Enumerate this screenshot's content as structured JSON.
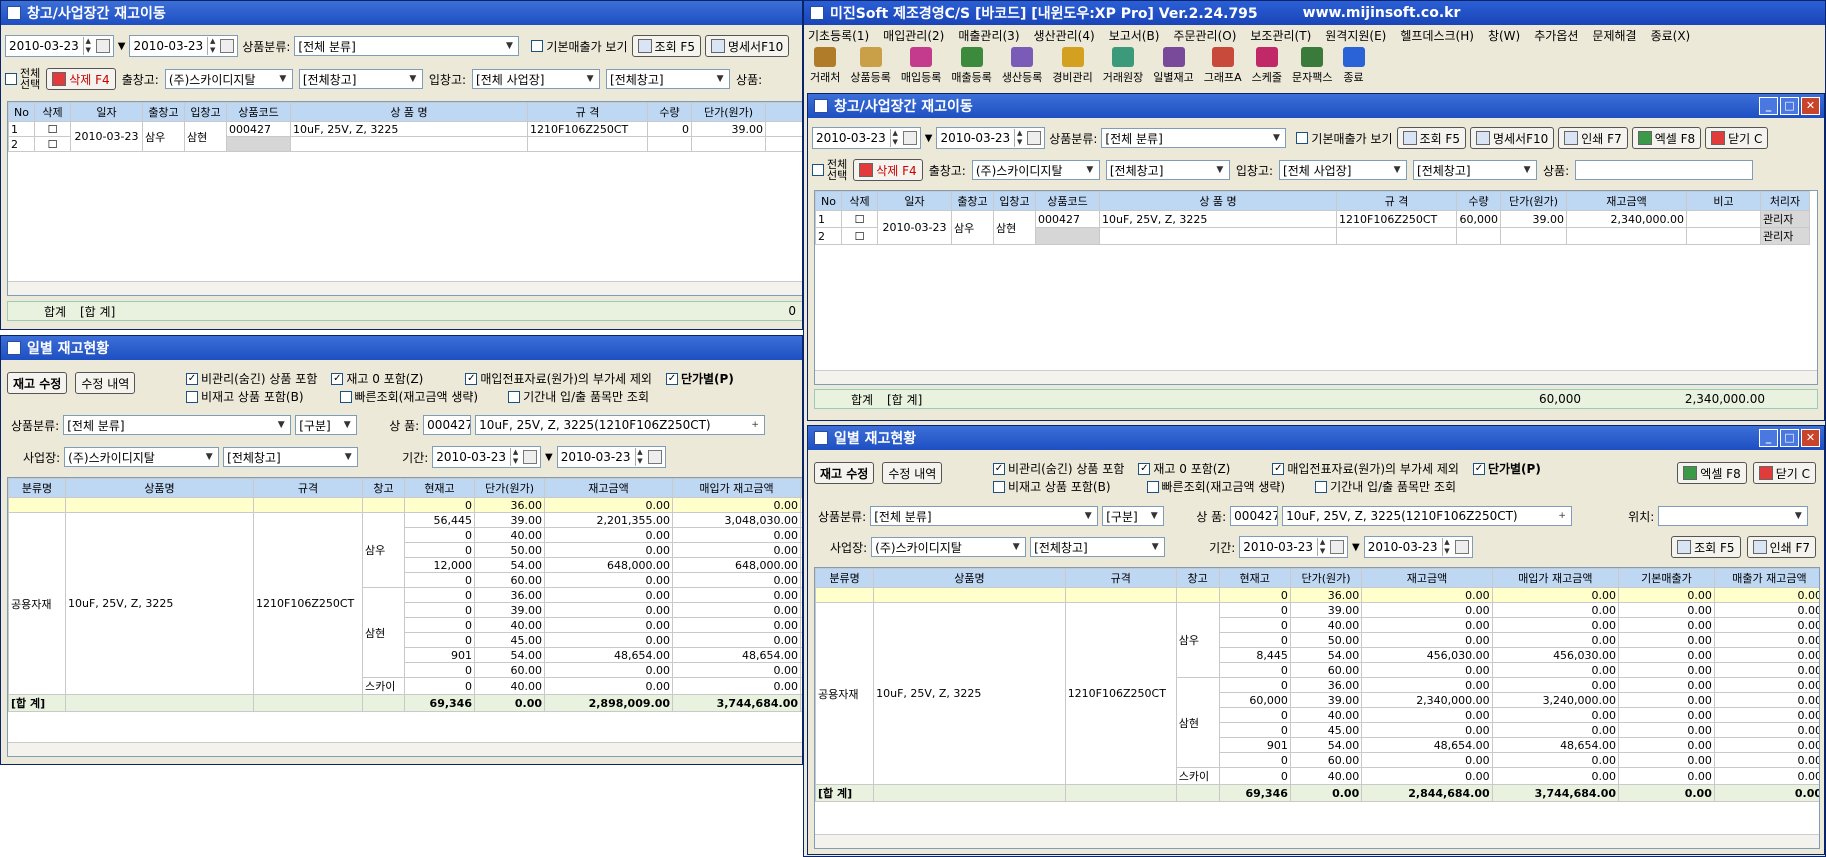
{
  "main_window": {
    "title": "미진Soft 제조경영C/S [바코드] [내윈도우:XP Pro] Ver.2.24.795",
    "url": "www.mijinsoft.co.kr",
    "menus": [
      "기초등록(1)",
      "매입관리(2)",
      "매출관리(3)",
      "생산관리(4)",
      "보고서(B)",
      "주문관리(O)",
      "보조관리(T)",
      "원격지원(E)",
      "헬프데스크(H)",
      "창(W)",
      "추가옵션",
      "문제해결",
      "종료(X)"
    ],
    "toolbar": [
      "거래처",
      "상품등록",
      "매입등록",
      "매출등록",
      "생산등록",
      "경비관리",
      "거래원장",
      "일별재고",
      "그래프A",
      "스케줄",
      "문자팩스",
      "종료"
    ]
  },
  "transfer": {
    "title": "창고/사업장간 재고이동",
    "date_from": "2010-03-23",
    "date_to": "2010-03-23",
    "category_label": "상품분류:",
    "category_value": "[전체 분류]",
    "basic_sales_label": "기본매출가 보기",
    "search_btn": "조회 F5",
    "detail_btn": "명세서F10",
    "print_btn": "인쇄 F7",
    "excel_btn": "엑셀 F8",
    "close_btn": "닫기 C",
    "select_all_1": "전체",
    "select_all_2": "선택",
    "delete_btn": "삭제 F4",
    "out_label": "출창고:",
    "out_company": "(주)스카이디지탈",
    "out_wh": "[전체창고]",
    "in_label": "입창고:",
    "in_site": "[전체 사업장]",
    "in_wh": "[전체창고]",
    "product_label": "상품:",
    "columns": [
      "No",
      "삭제",
      "일자",
      "출창고",
      "입창고",
      "상품코드",
      "상 품 명",
      "규 격",
      "수량",
      "단가(원가)",
      "재고금액",
      "비고",
      "처리자"
    ],
    "columns_left": [
      "No",
      "삭제",
      "일자",
      "출창고",
      "입창고",
      "상품코드",
      "상 품 명",
      "규 격",
      "수량",
      "단가(원가)",
      "재고"
    ],
    "rows": [
      {
        "no": "1",
        "date": "2010-03-23",
        "out": "삼우",
        "in": "삼현",
        "code": "000427",
        "name": "10uF, 25V, Z, 3225",
        "spec": "1210F106Z250CT",
        "qty": "60,000",
        "price": "39.00",
        "amount": "2,340,000.00",
        "note": "",
        "user": "관리자"
      },
      {
        "no": "2",
        "date": "",
        "out": "",
        "in": "",
        "code": "",
        "name": "",
        "spec": "",
        "qty": "",
        "price": "",
        "amount": "",
        "note": "",
        "user": "관리자"
      }
    ],
    "left_qty": "0",
    "total_label": "합계",
    "total_bracket": "[합 계]",
    "total_qty": "60,000",
    "total_amount": "2,340,000.00",
    "left_total_qty": "0"
  },
  "daily": {
    "title": "일별 재고현황",
    "adjust_btn": "재고 수정",
    "history_btn": "수정 내역",
    "opts": [
      "비관리(숨긴) 상품 포함",
      "재고 0 포함(Z)",
      "매입전표자료(원가)의 부가세 제외",
      "단가별(P)",
      "비재고 상품 포함(B)",
      "빠른조회(재고금액 생략)",
      "기간내 입/출 품목만 조회"
    ],
    "category_label": "상품분류:",
    "category_value": "[전체 분류]",
    "group_value": "[구분]",
    "product_label": "상 품:",
    "product_code": "000427",
    "product_name": "10uF, 25V, Z, 3225(1210F106Z250CT)",
    "location_label": "위치:",
    "site_label": "사업장:",
    "site_value": "(주)스카이디지탈",
    "wh_value": "[전체창고]",
    "period_label": "기간:",
    "date_from": "2010-03-23",
    "date_to": "2010-03-23",
    "search_btn": "조회 F5",
    "print_btn": "인쇄 F7",
    "excel_btn": "엑셀 F8",
    "close_btn": "닫기 C",
    "columns": [
      "분류명",
      "상품명",
      "규격",
      "창고",
      "현재고",
      "단가(원가)",
      "재고금액",
      "매입가 재고금액",
      "기본매출가",
      "매출가 재고금액"
    ],
    "group": {
      "category": "공용자재",
      "name": "10uF, 25V, Z, 3225",
      "spec": "1210F106Z250CT"
    },
    "rows_right": [
      {
        "wh": "",
        "stock": "0",
        "price": "36.00",
        "amt": "0.00",
        "pamt": "0.00",
        "base": "0.00",
        "samt": "0.00"
      },
      {
        "wh": "삼우",
        "stock": "0",
        "price": "39.00",
        "amt": "0.00",
        "pamt": "0.00",
        "base": "0.00",
        "samt": "0.00"
      },
      {
        "wh": "",
        "stock": "0",
        "price": "40.00",
        "amt": "0.00",
        "pamt": "0.00",
        "base": "0.00",
        "samt": "0.00"
      },
      {
        "wh": "",
        "stock": "0",
        "price": "50.00",
        "amt": "0.00",
        "pamt": "0.00",
        "base": "0.00",
        "samt": "0.00"
      },
      {
        "wh": "",
        "stock": "8,445",
        "price": "54.00",
        "amt": "456,030.00",
        "pamt": "456,030.00",
        "base": "0.00",
        "samt": "0.00"
      },
      {
        "wh": "",
        "stock": "0",
        "price": "60.00",
        "amt": "0.00",
        "pamt": "0.00",
        "base": "0.00",
        "samt": "0.00"
      },
      {
        "wh": "",
        "stock": "0",
        "price": "36.00",
        "amt": "0.00",
        "pamt": "0.00",
        "base": "0.00",
        "samt": "0.00"
      },
      {
        "wh": "삼현",
        "stock": "60,000",
        "price": "39.00",
        "amt": "2,340,000.00",
        "pamt": "3,240,000.00",
        "base": "0.00",
        "samt": "0.00"
      },
      {
        "wh": "",
        "stock": "0",
        "price": "40.00",
        "amt": "0.00",
        "pamt": "0.00",
        "base": "0.00",
        "samt": "0.00"
      },
      {
        "wh": "",
        "stock": "0",
        "price": "45.00",
        "amt": "0.00",
        "pamt": "0.00",
        "base": "0.00",
        "samt": "0.00"
      },
      {
        "wh": "",
        "stock": "901",
        "price": "54.00",
        "amt": "48,654.00",
        "pamt": "48,654.00",
        "base": "0.00",
        "samt": "0.00"
      },
      {
        "wh": "",
        "stock": "0",
        "price": "60.00",
        "amt": "0.00",
        "pamt": "0.00",
        "base": "0.00",
        "samt": "0.00"
      },
      {
        "wh": "스카이",
        "stock": "0",
        "price": "40.00",
        "amt": "0.00",
        "pamt": "0.00",
        "base": "0.00",
        "samt": "0.00"
      }
    ],
    "total_right": {
      "label": "[합 계]",
      "stock": "69,346",
      "price": "0.00",
      "amt": "2,844,684.00",
      "pamt": "3,744,684.00",
      "base": "0.00",
      "samt": "0.00"
    },
    "rows_left": [
      {
        "stock": "0",
        "price": "36.00",
        "amt": "0.00",
        "pamt": "0.00"
      },
      {
        "stock": "56,445",
        "price": "39.00",
        "amt": "2,201,355.00",
        "pamt": "3,048,030.00"
      },
      {
        "stock": "0",
        "price": "40.00",
        "amt": "0.00",
        "pamt": "0.00"
      },
      {
        "stock": "0",
        "price": "50.00",
        "amt": "0.00",
        "pamt": "0.00"
      },
      {
        "stock": "12,000",
        "price": "54.00",
        "amt": "648,000.00",
        "pamt": "648,000.00"
      },
      {
        "stock": "0",
        "price": "60.00",
        "amt": "0.00",
        "pamt": "0.00"
      },
      {
        "stock": "0",
        "price": "36.00",
        "amt": "0.00",
        "pamt": "0.00"
      },
      {
        "stock": "0",
        "price": "39.00",
        "amt": "0.00",
        "pamt": "0.00"
      },
      {
        "stock": "0",
        "price": "40.00",
        "amt": "0.00",
        "pamt": "0.00"
      },
      {
        "stock": "0",
        "price": "45.00",
        "amt": "0.00",
        "pamt": "0.00"
      },
      {
        "stock": "901",
        "price": "54.00",
        "amt": "48,654.00",
        "pamt": "48,654.00"
      },
      {
        "stock": "0",
        "price": "60.00",
        "amt": "0.00",
        "pamt": "0.00"
      },
      {
        "stock": "0",
        "price": "40.00",
        "amt": "0.00",
        "pamt": "0.00"
      }
    ],
    "total_left": {
      "label": "[합 계]",
      "stock": "69,346",
      "price": "0.00",
      "amt": "2,898,009.00",
      "pamt": "3,744,684.00"
    },
    "wh_names": {
      "a": "삼우",
      "b": "삼현",
      "c": "스카이"
    }
  }
}
